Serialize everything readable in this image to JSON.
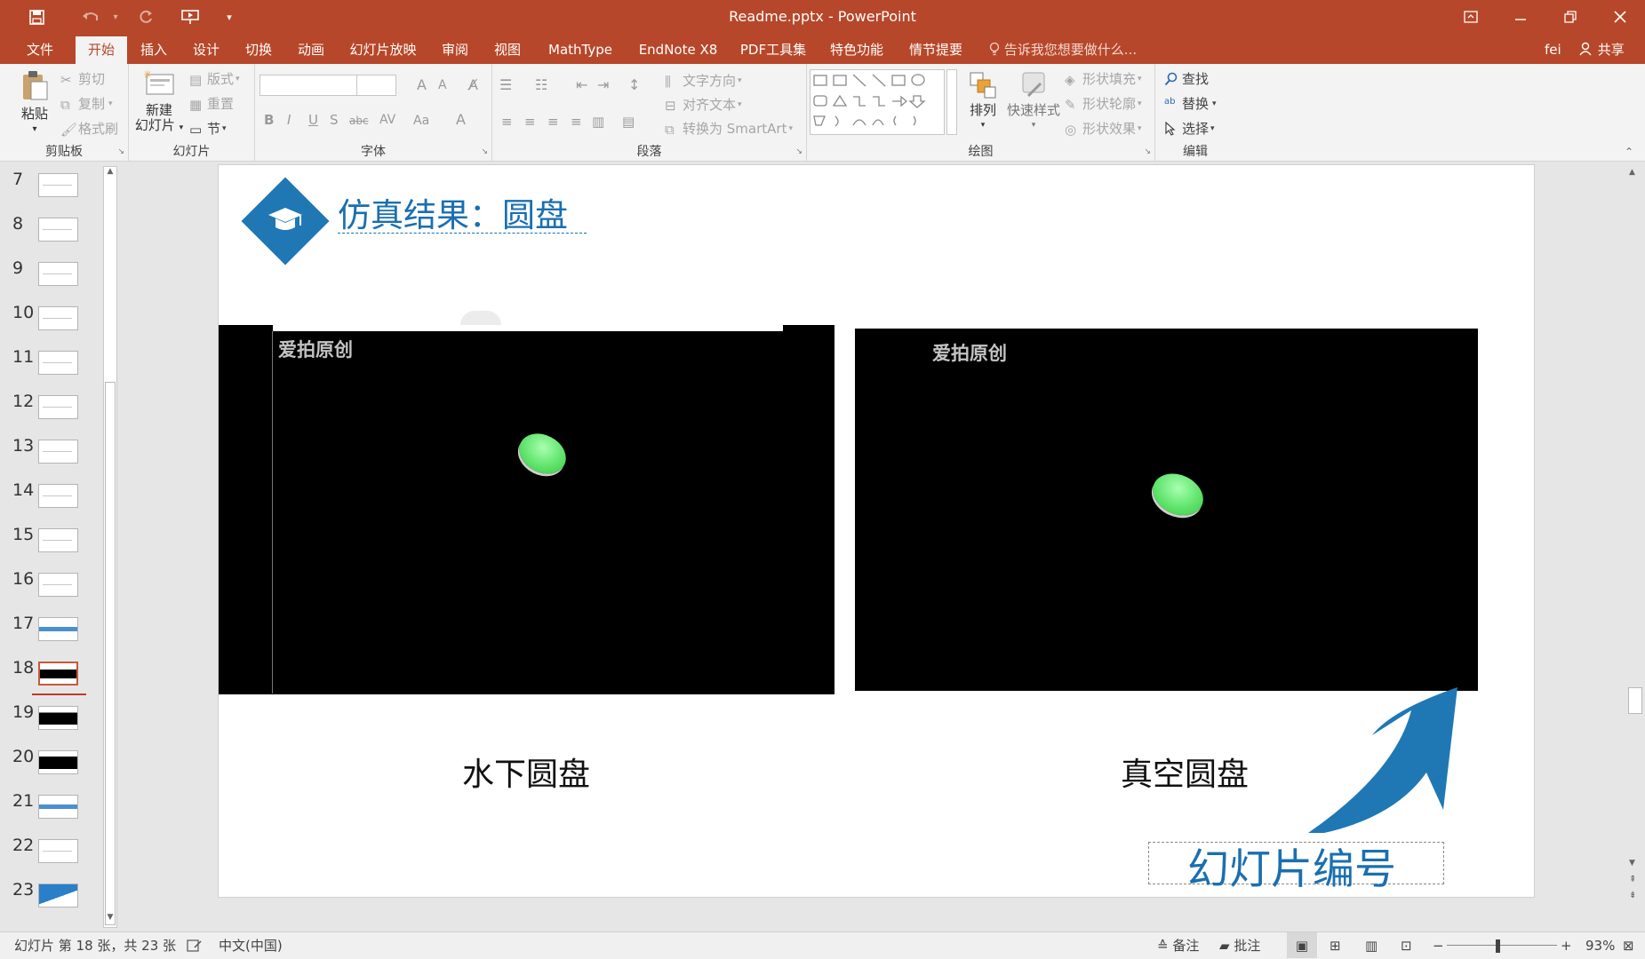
{
  "titlebar": {
    "title": "Readme.pptx - PowerPoint",
    "qat": [
      "save-icon",
      "undo-icon",
      "redo-icon",
      "start-from-beginning-icon",
      "customize-qat-icon"
    ],
    "controls": [
      "ribbon-display-options-icon",
      "minimize-icon",
      "restore-icon",
      "close-icon"
    ]
  },
  "tabs": {
    "items": [
      "文件",
      "开始",
      "插入",
      "设计",
      "切换",
      "动画",
      "幻灯片放映",
      "审阅",
      "视图",
      "MathType",
      "EndNote X8",
      "PDF工具集",
      "特色功能",
      "情节提要"
    ],
    "active": "开始",
    "tell_me": "告诉我您想要做什么...",
    "user": "fei",
    "share": "共享"
  },
  "ribbon": {
    "clipboard": {
      "label": "剪贴板",
      "paste": "粘贴",
      "cut": "剪切",
      "copy": "复制",
      "format_painter": "格式刷"
    },
    "slides": {
      "label": "幻灯片",
      "new_slide_line1": "新建",
      "new_slide_line2": "幻灯片",
      "layout": "版式",
      "reset": "重置",
      "section": "节"
    },
    "font": {
      "label": "字体",
      "bold": "B",
      "italic": "I",
      "underline": "U",
      "shadow": "S",
      "strike": "abc",
      "spacing": "AV",
      "case": "Aa",
      "color": "A",
      "grow": "A",
      "shrink": "A"
    },
    "paragraph": {
      "label": "段落",
      "text_direction": "文字方向",
      "align_text": "对齐文本",
      "smartart": "转换为 SmartArt"
    },
    "drawing": {
      "label": "绘图",
      "arrange": "排列",
      "quick_styles": "快速样式",
      "fill": "形状填充",
      "outline": "形状轮廓",
      "effects": "形状效果"
    },
    "editing": {
      "label": "编辑",
      "find": "查找",
      "replace": "替换",
      "select": "选择"
    }
  },
  "thumbnails": {
    "numbers": [
      "7",
      "8",
      "9",
      "10",
      "11",
      "12",
      "13",
      "14",
      "15",
      "16",
      "17",
      "18",
      "19",
      "20",
      "21",
      "22",
      "23"
    ],
    "selected": "18"
  },
  "slide": {
    "title": "仿真结果：圆盘",
    "watermark_left": "爱拍原创",
    "watermark_right": "爱拍原创",
    "caption_left": "水下圆盘",
    "caption_right": "真空圆盘",
    "slide_number_label": "幻灯片编号",
    "colors": {
      "accent": "#1a6fb0",
      "ball": "#5fe36b",
      "arrow": "#1f78b4"
    }
  },
  "status": {
    "slide_info": "幻灯片 第 18 张，共 23 张",
    "language": "中文(中国)",
    "notes": "备注",
    "comments": "批注",
    "zoom": "93%"
  }
}
